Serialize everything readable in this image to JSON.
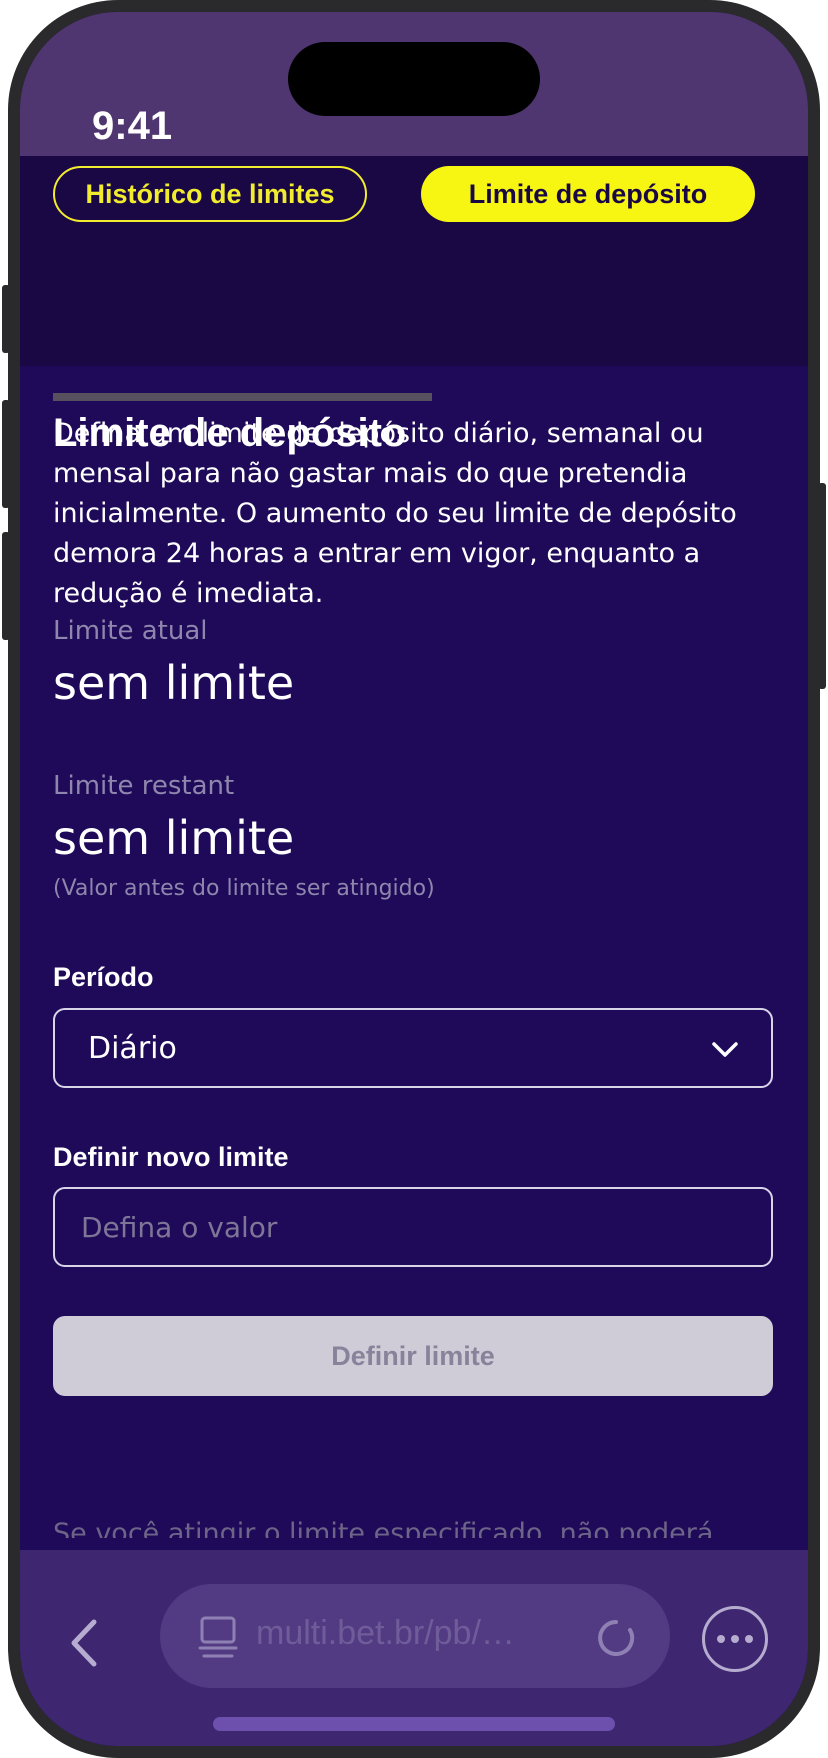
{
  "status_bar": {
    "time": "9:41"
  },
  "tabs": {
    "history_label": "Histórico de limites",
    "deposit_label": "Limite de depósito"
  },
  "page": {
    "title": "Limite de depósito",
    "description": "Defina um limite de depósito diário, semanal ou mensal para não gastar mais do que pretendia inicialmente. O aumento do seu limite de depósito demora 24 horas a entrar em vigor, enquanto a redução é imediata."
  },
  "current_limit": {
    "label": "Limite atual",
    "value": "sem limite"
  },
  "remaining_limit": {
    "label": "Limite restant",
    "value": "sem limite",
    "note": "(Valor antes do limite ser atingido)"
  },
  "period": {
    "label": "Período",
    "selected": "Diário"
  },
  "new_limit": {
    "label": "Definir novo limite",
    "placeholder": "Defina o valor"
  },
  "submit_label": "Definir limite",
  "footer_cut_text": "Se você atingir o limite especificado, não poderá",
  "browser": {
    "url": "multi.bet.br/pb/…",
    "icons": [
      "back-icon",
      "laptop-icon",
      "reload-icon",
      "more-icon"
    ]
  },
  "colors": {
    "accent_yellow": "#f7f512",
    "background": "#1e0a58",
    "header_background": "#1a0845",
    "bar_background": "#3e2670"
  }
}
